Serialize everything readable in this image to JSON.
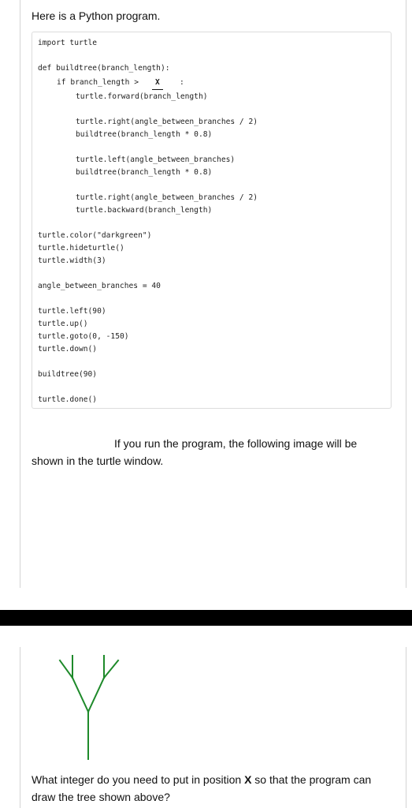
{
  "intro_text": "Here is a Python program.",
  "code": {
    "l1": "import turtle",
    "l2": "def buildtree(branch_length):",
    "l3a": "if branch_length >",
    "blank_label": "X",
    "l3c": ":",
    "l4": "turtle.forward(branch_length)",
    "l5": "turtle.right(angle_between_branches / 2)",
    "l6": "buildtree(branch_length * 0.8)",
    "l7": "turtle.left(angle_between_branches)",
    "l8": "buildtree(branch_length * 0.8)",
    "l9": "turtle.right(angle_between_branches / 2)",
    "l10": "turtle.backward(branch_length)",
    "l11": "turtle.color(\"darkgreen\")",
    "l12": "turtle.hideturtle()",
    "l13": "turtle.width(3)",
    "l14": "angle_between_branches = 40",
    "l15": "turtle.left(90)",
    "l16": "turtle.up()",
    "l17": "turtle.goto(0, -150)",
    "l18": "turtle.down()",
    "l19": "buildtree(90)",
    "l20": "turtle.done()"
  },
  "para_line1": "If you run the program, the following image will be",
  "para_line2": "shown in the turtle window.",
  "question": {
    "before": "What integer do you need to put in position ",
    "x": "X",
    "after": " so that the program can draw the tree shown above?"
  },
  "colors": {
    "tree": "#1e8a2a",
    "bar": "#000000"
  }
}
